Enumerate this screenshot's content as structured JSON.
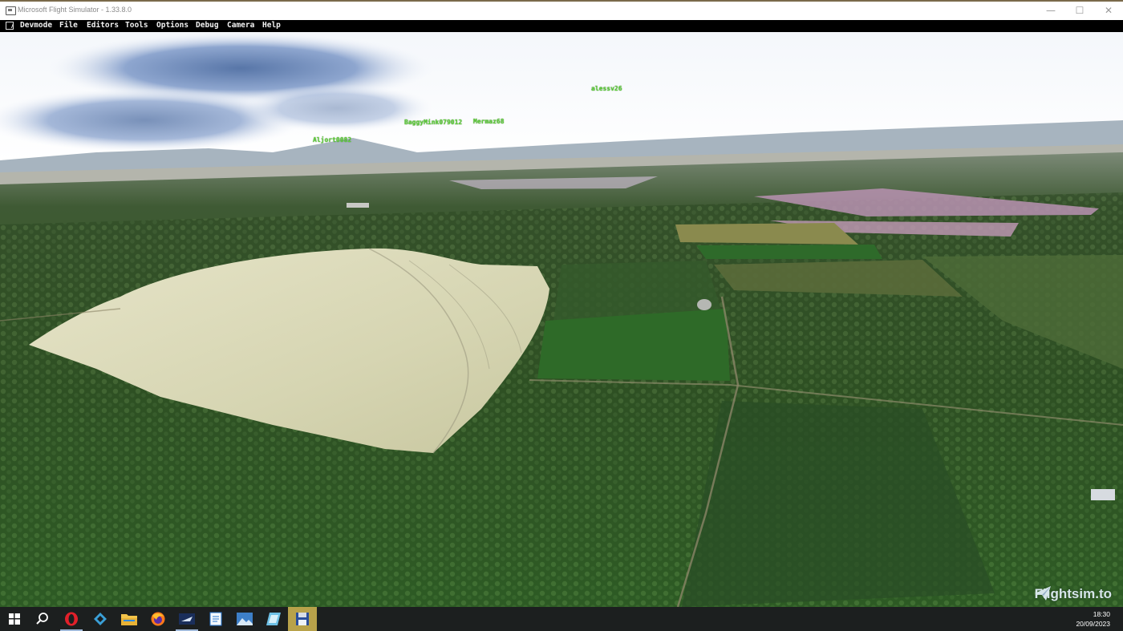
{
  "window": {
    "title": "Microsoft Flight Simulator - 1.33.8.0",
    "min_glyph": "—",
    "max_glyph": "☐",
    "close_glyph": "✕"
  },
  "menu": {
    "items": [
      "Devmode",
      "File",
      "Editors",
      "Tools",
      "Options",
      "Debug",
      "Camera",
      "Help"
    ]
  },
  "players": [
    "Aljort0082",
    "BaggyMink079012",
    "Mermaz68",
    "alessv26"
  ],
  "watermark": {
    "text": "Flightsim.to"
  },
  "taskbar": {
    "apps": [
      "start-icon",
      "search-icon",
      "opera-icon",
      "kodi-icon",
      "file-explorer-icon",
      "firefox-icon",
      "flight-app-icon",
      "notepad-icon",
      "photos-icon",
      "app-icon",
      "save-disk-icon"
    ],
    "time": "18:30",
    "date": "20/09/2023"
  },
  "colors": {
    "menu_text": "#f2f2f2",
    "player_tag": "#5fd23a",
    "taskbar_bg": "#1c1f1f",
    "taskbar_highlight": "#b8a24a"
  }
}
